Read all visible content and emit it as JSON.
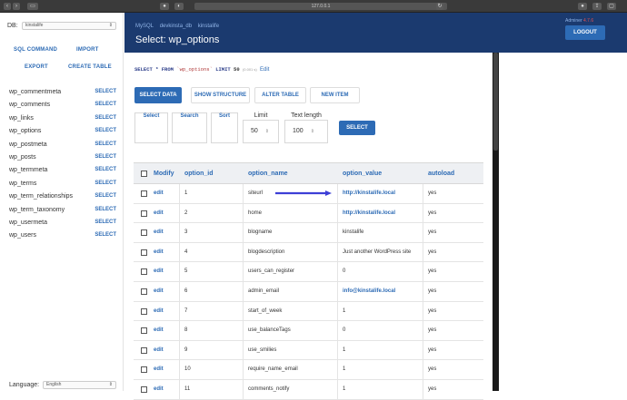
{
  "browser": {
    "url": "127.0.0.1"
  },
  "sidebar": {
    "db_label": "DB:",
    "db_value": "kinstalife",
    "links": [
      "SQL COMMAND",
      "IMPORT",
      "EXPORT",
      "CREATE TABLE"
    ],
    "tables": [
      {
        "name": "wp_commentmeta",
        "select": "SELECT"
      },
      {
        "name": "wp_comments",
        "select": "SELECT"
      },
      {
        "name": "wp_links",
        "select": "SELECT"
      },
      {
        "name": "wp_options",
        "select": "SELECT"
      },
      {
        "name": "wp_postmeta",
        "select": "SELECT"
      },
      {
        "name": "wp_posts",
        "select": "SELECT"
      },
      {
        "name": "wp_termmeta",
        "select": "SELECT"
      },
      {
        "name": "wp_terms",
        "select": "SELECT"
      },
      {
        "name": "wp_term_relationships",
        "select": "SELECT"
      },
      {
        "name": "wp_term_taxonomy",
        "select": "SELECT"
      },
      {
        "name": "wp_usermeta",
        "select": "SELECT"
      },
      {
        "name": "wp_users",
        "select": "SELECT"
      }
    ],
    "language_label": "Language:",
    "language_value": "English"
  },
  "header": {
    "breadcrumbs": [
      "MySQL",
      "devkinsta_db",
      "kinstalife"
    ],
    "title": "Select: wp_options",
    "adminer_label": "Adminer",
    "adminer_version": "4.7.6",
    "logout": "LOGOUT"
  },
  "query": {
    "select_kw": "SELECT",
    "star": "*",
    "from_kw": "FROM",
    "table": "`wp_options`",
    "limit_kw": "LIMIT",
    "limit_val": "50",
    "time": "(0.001 s)",
    "edit": "Edit"
  },
  "actions": [
    "SELECT DATA",
    "SHOW STRUCTURE",
    "ALTER TABLE",
    "NEW ITEM"
  ],
  "filters": {
    "select": "Select",
    "search": "Search",
    "sort": "Sort",
    "limit_label": "Limit",
    "limit_value": "50",
    "textlen_label": "Text length",
    "textlen_value": "100",
    "submit": "SELECT"
  },
  "table": {
    "columns": [
      "Modify",
      "option_id",
      "option_name",
      "option_value",
      "autoload"
    ],
    "edit_label": "edit",
    "rows": [
      {
        "id": "1",
        "name": "siteurl",
        "value": "http://kinstalife.local",
        "link": true,
        "autoload": "yes"
      },
      {
        "id": "2",
        "name": "home",
        "value": "http://kinstalife.local",
        "link": true,
        "autoload": "yes"
      },
      {
        "id": "3",
        "name": "blogname",
        "value": "kinstalife",
        "link": false,
        "autoload": "yes"
      },
      {
        "id": "4",
        "name": "blogdescription",
        "value": "Just another WordPress site",
        "link": false,
        "autoload": "yes"
      },
      {
        "id": "5",
        "name": "users_can_register",
        "value": "0",
        "link": false,
        "autoload": "yes"
      },
      {
        "id": "6",
        "name": "admin_email",
        "value": "info@kinstalife.local",
        "link": true,
        "autoload": "yes"
      },
      {
        "id": "7",
        "name": "start_of_week",
        "value": "1",
        "link": false,
        "autoload": "yes"
      },
      {
        "id": "8",
        "name": "use_balanceTags",
        "value": "0",
        "link": false,
        "autoload": "yes"
      },
      {
        "id": "9",
        "name": "use_smilies",
        "value": "1",
        "link": false,
        "autoload": "yes"
      },
      {
        "id": "10",
        "name": "require_name_email",
        "value": "1",
        "link": false,
        "autoload": "yes"
      },
      {
        "id": "11",
        "name": "comments_notify",
        "value": "1",
        "link": false,
        "autoload": "yes"
      }
    ]
  },
  "colors": {
    "accent": "#2d6bb5",
    "header_bg": "#1b3a6f",
    "arrow": "#3d3fd6"
  }
}
